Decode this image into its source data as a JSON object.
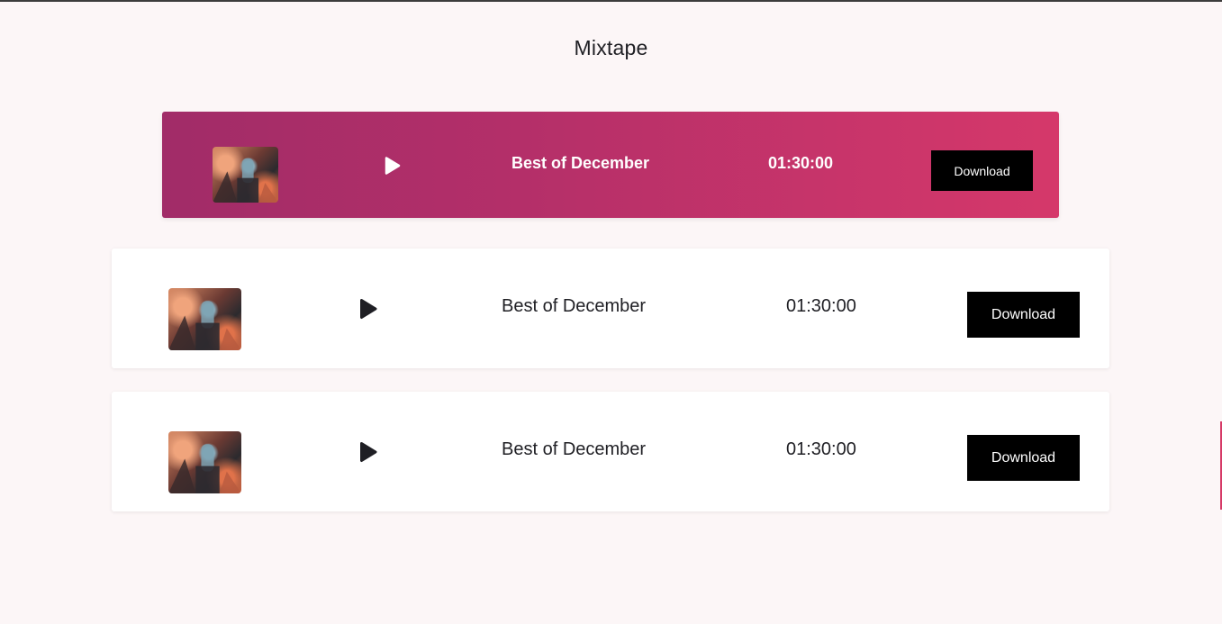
{
  "page": {
    "title": "Mixtape"
  },
  "colors": {
    "background": "#fcf6f7",
    "active_gradient_start": "#a12c68",
    "active_gradient_end": "#d5386a",
    "card_background": "#ffffff",
    "download_button": "#000000"
  },
  "tracks": [
    {
      "title": "Best of December",
      "duration": "01:30:00",
      "download_label": "Download",
      "play_icon": "play-icon",
      "thumbnail": "album-art-thumbnail",
      "active": true
    },
    {
      "title": "Best of December",
      "duration": "01:30:00",
      "download_label": "Download",
      "play_icon": "play-icon",
      "thumbnail": "album-art-thumbnail",
      "active": false
    },
    {
      "title": "Best of December",
      "duration": "01:30:00",
      "download_label": "Download",
      "play_icon": "play-icon",
      "thumbnail": "album-art-thumbnail",
      "active": false
    }
  ]
}
